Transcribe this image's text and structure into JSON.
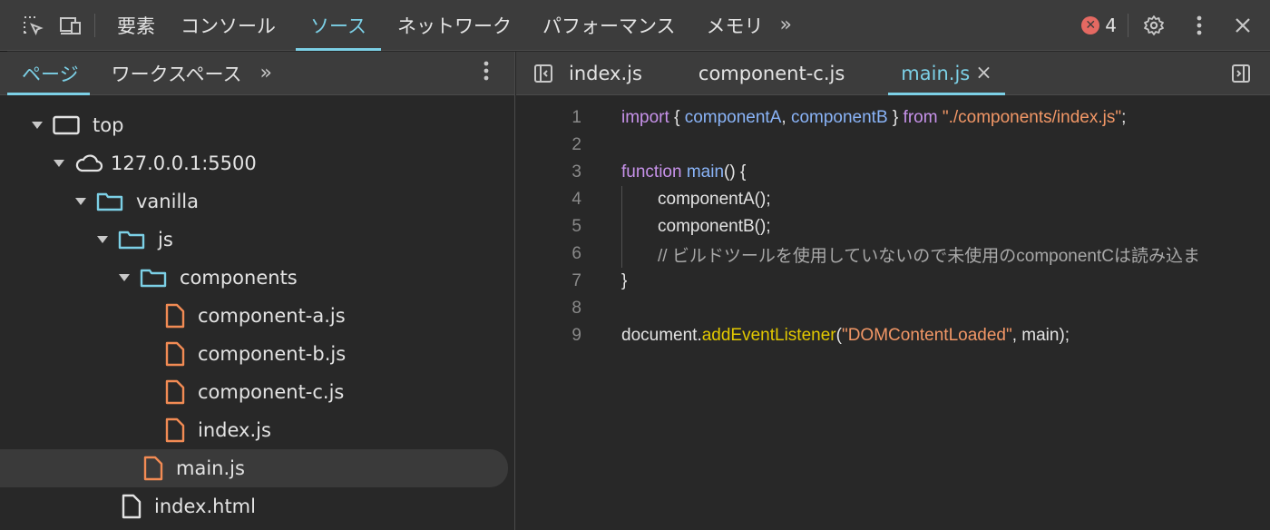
{
  "toolbar": {
    "tabs": [
      {
        "label": "要素"
      },
      {
        "label": "コンソール"
      },
      {
        "label": "ソース"
      },
      {
        "label": "ネットワーク"
      },
      {
        "label": "パフォーマンス"
      },
      {
        "label": "メモリ"
      }
    ],
    "more_label": "»",
    "error_count": "4"
  },
  "navigator": {
    "tabs": [
      {
        "label": "ページ"
      },
      {
        "label": "ワークスペース"
      }
    ],
    "more_label": "»",
    "tree": [
      {
        "label": "top"
      },
      {
        "label": "127.0.0.1:5500"
      },
      {
        "label": "vanilla"
      },
      {
        "label": "js"
      },
      {
        "label": "components"
      },
      {
        "label": "component-a.js"
      },
      {
        "label": "component-b.js"
      },
      {
        "label": "component-c.js"
      },
      {
        "label": "index.js"
      },
      {
        "label": "main.js"
      },
      {
        "label": "index.html"
      }
    ]
  },
  "editor": {
    "tabs": [
      {
        "label": "index.js"
      },
      {
        "label": "component-c.js"
      },
      {
        "label": "main.js"
      }
    ],
    "close_glyph": "×",
    "lines": [
      {
        "num": "1",
        "t": [
          "import",
          " { ",
          "componentA",
          ", ",
          "componentB",
          " } ",
          "from",
          " ",
          "\"./components/index.js\"",
          ";"
        ]
      },
      {
        "num": "2"
      },
      {
        "num": "3",
        "t": [
          "function",
          " ",
          "main",
          "() {"
        ]
      },
      {
        "num": "4",
        "t": [
          "componentA();"
        ]
      },
      {
        "num": "5",
        "t": [
          "componentB();"
        ]
      },
      {
        "num": "6",
        "t": [
          "// ビルドツールを使用していないので未使用のcomponentCは読み込ま"
        ]
      },
      {
        "num": "7",
        "t": [
          "}"
        ]
      },
      {
        "num": "8"
      },
      {
        "num": "9",
        "t": [
          "document.",
          "addEventListener",
          "(",
          "\"DOMContentLoaded\"",
          ", main);"
        ]
      }
    ]
  },
  "colors": {
    "accent": "#7cd0e6",
    "file_icon": "#f28b54",
    "folder_icon": "#7cd0e6",
    "error": "#e46962"
  }
}
